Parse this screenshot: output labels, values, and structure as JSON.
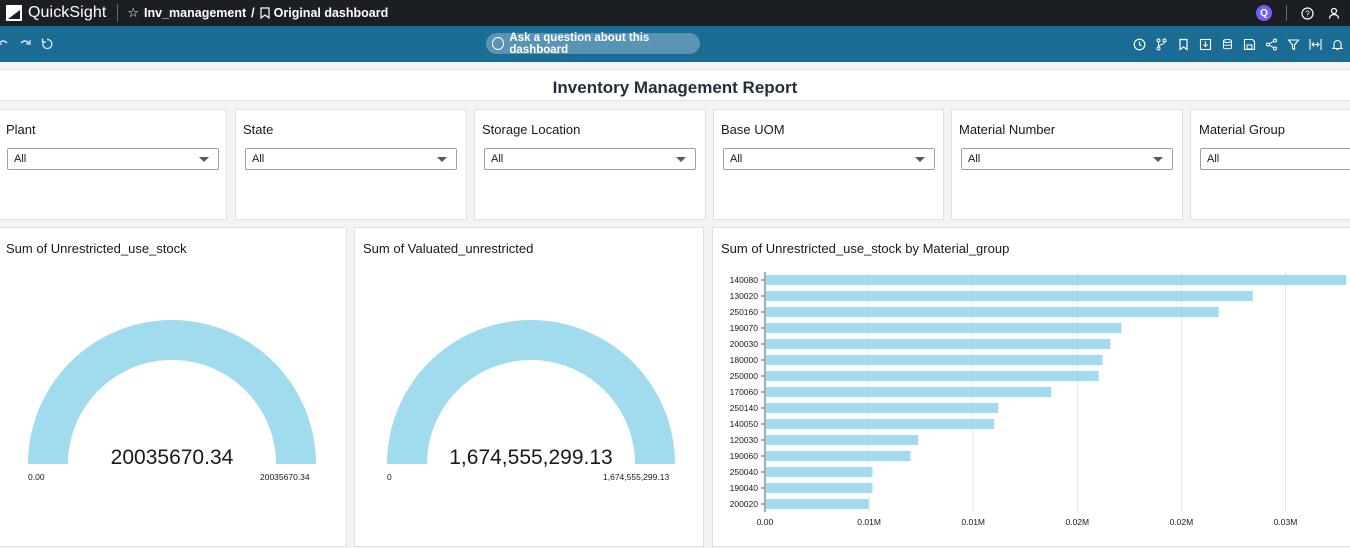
{
  "app": {
    "name": "QuickSight"
  },
  "breadcrumb": {
    "analysis": "Inv_management",
    "separator": "/",
    "dashboard": "Original dashboard"
  },
  "topbar": {
    "q_badge": "Q"
  },
  "toolbar": {
    "ask_label": "Ask a question about this dashboard"
  },
  "report": {
    "title": "Inventory Management Report"
  },
  "filters": [
    {
      "label": "Plant",
      "value": "All"
    },
    {
      "label": "State",
      "value": "All"
    },
    {
      "label": "Storage Location",
      "value": "All"
    },
    {
      "label": "Base UOM",
      "value": "All"
    },
    {
      "label": "Material Number",
      "value": "All"
    },
    {
      "label": "Material Group",
      "value": "All"
    }
  ],
  "gauges": [
    {
      "title": "Sum of Unrestricted_use_stock",
      "value": "20035670.34",
      "min": "0.00",
      "max": "20035670.34"
    },
    {
      "title": "Sum of Valuated_unrestricted",
      "value": "1,674,555,299.13",
      "min": "0",
      "max": "1,674,555,299.13"
    }
  ],
  "colors": {
    "accent_bar": "#a0dcee",
    "toolbar": "#1a6c95",
    "topbar": "#1b1f24"
  },
  "chart_data": {
    "type": "bar",
    "orientation": "horizontal",
    "title": "Sum of Unrestricted_use_stock by Material_group",
    "categories": [
      "140080",
      "130020",
      "250160",
      "190070",
      "200030",
      "180000",
      "250000",
      "170060",
      "250140",
      "140050",
      "120030",
      "190060",
      "250040",
      "190040",
      "200020"
    ],
    "values": [
      0.0305,
      0.0256,
      0.0238,
      0.0187,
      0.0181,
      0.0177,
      0.0175,
      0.015,
      0.0122,
      0.012,
      0.008,
      0.0076,
      0.0056,
      0.0056,
      0.0054
    ],
    "xticks": [
      "0.00",
      "0.01M",
      "0.01M",
      "0.02M",
      "0.02M",
      "0.03M"
    ],
    "xlim": [
      0,
      0.0305
    ],
    "grid": true
  }
}
